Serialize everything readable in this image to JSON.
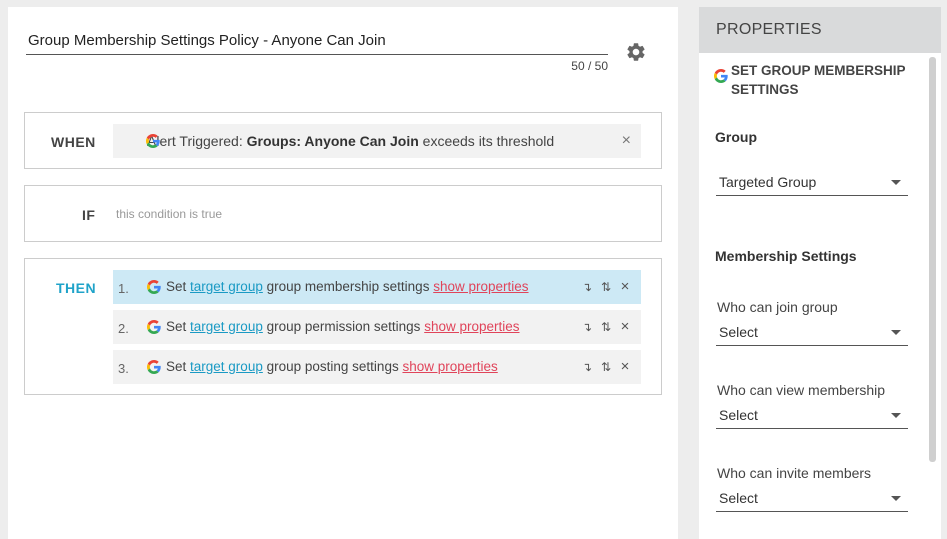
{
  "editor": {
    "title_value": "Group Membership Settings Policy - Anyone Can Join",
    "char_count": "50 / 50"
  },
  "when": {
    "label": "WHEN",
    "prefix": "Alert Triggered:",
    "alert_name": "Groups: Anyone Can Join",
    "suffix": "exceeds its threshold",
    "remove": "×"
  },
  "if": {
    "label": "IF",
    "condition": "this condition is true"
  },
  "then": {
    "label": "THEN",
    "actions": [
      {
        "num": "1.",
        "set": "Set",
        "target": "target group",
        "desc": "group membership settings",
        "show": "show properties"
      },
      {
        "num": "2.",
        "set": "Set",
        "target": "target group",
        "desc": "group permission settings",
        "show": "show properties"
      },
      {
        "num": "3.",
        "set": "Set",
        "target": "target group",
        "desc": "group posting settings",
        "show": "show properties"
      }
    ],
    "icons": {
      "move_down": "↴",
      "reorder": "⇅",
      "remove": "×"
    }
  },
  "properties": {
    "header": "PROPERTIES",
    "title": "SET GROUP MEMBERSHIP SETTINGS",
    "group_label": "Group",
    "group_value": "Targeted Group",
    "membership_label": "Membership Settings",
    "fields": [
      {
        "label": "Who can join group",
        "value": "Select"
      },
      {
        "label": "Who can view membership",
        "value": "Select"
      },
      {
        "label": "Who can invite members",
        "value": "Select"
      }
    ]
  },
  "colors": {
    "accent": "#1fa3c9",
    "link_red": "#e0445a",
    "active_row": "#cde9f5"
  },
  "icons": [
    "gear-icon",
    "google-icon",
    "move-down-icon",
    "reorder-icon",
    "close-icon",
    "chevron-down-icon"
  ]
}
